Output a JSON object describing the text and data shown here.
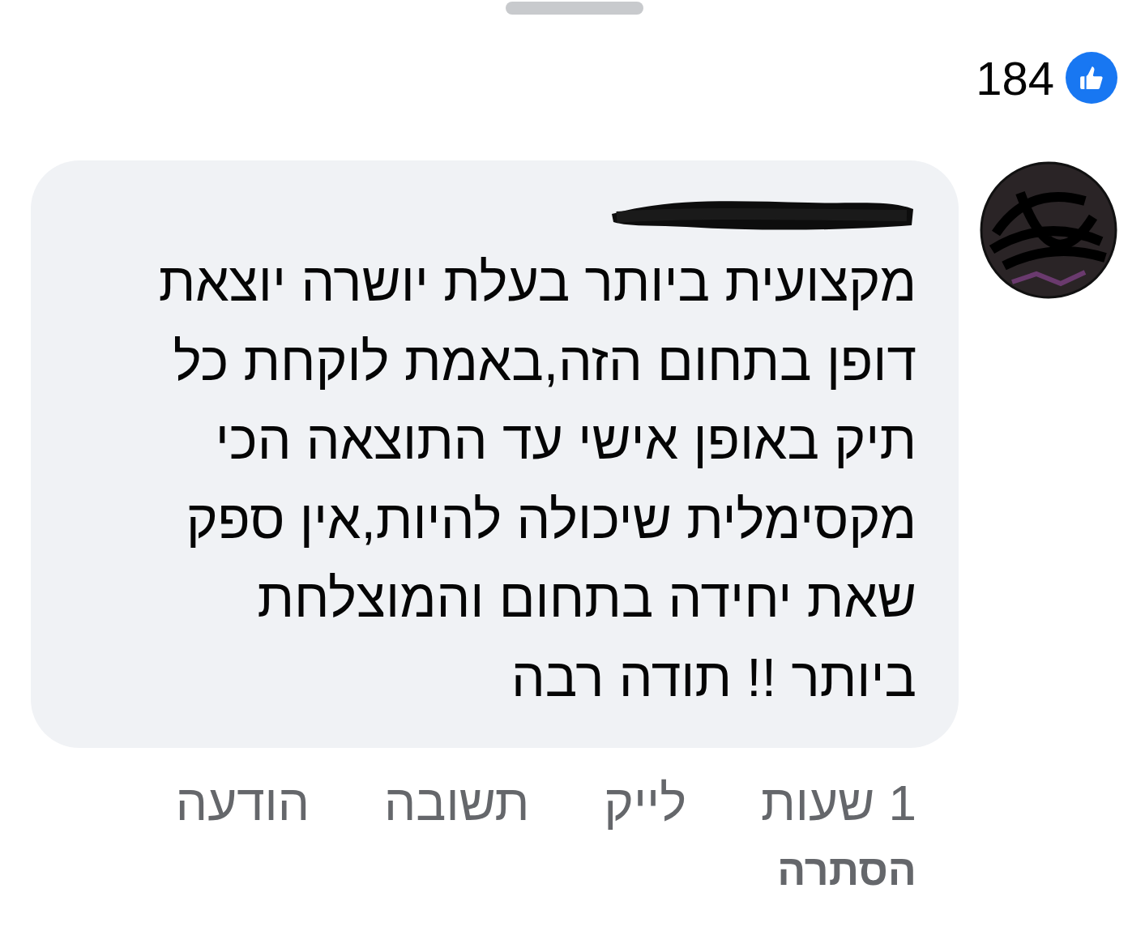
{
  "reactions": {
    "count": "184",
    "kind": "like"
  },
  "comment": {
    "author_redacted": true,
    "text": "מקצועית ביותר בעלת יושרה יוצאת\nדופן בתחום הזה,באמת לוקחת כל\nתיק באופן אישי עד התוצאה הכי\nמקסימלית שיכולה להיות,אין ספק\nשאת יחידה בתחום והמוצלחת\nביותר !! תודה רבה",
    "time": "1 שעות",
    "actions": [
      "לייק",
      "תשובה",
      "הודעה"
    ],
    "hide": "הסתרה"
  }
}
